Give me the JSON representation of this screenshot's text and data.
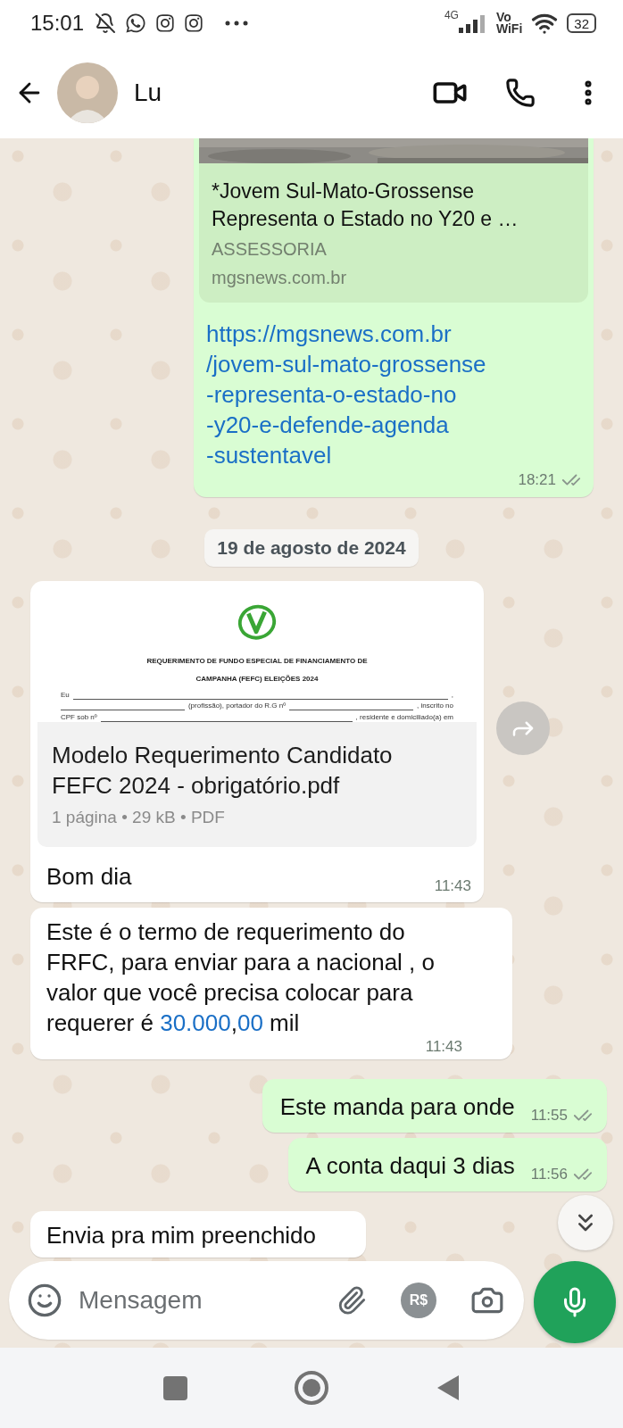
{
  "status_bar": {
    "time": "15:01",
    "network": "4G",
    "calling_top": "Vo",
    "calling_bottom": "WiFi",
    "battery": "32"
  },
  "header": {
    "contact_name": "Lu"
  },
  "messages": [
    {
      "kind": "link",
      "outgoing": true,
      "preview_title": "*Jovem Sul-Mato-Grossense Representa o Estado no Y20 e …",
      "preview_site": "ASSESSORIA",
      "preview_domain": "mgsnews.com.br",
      "url_lines": [
        "https://mgsnews.com.br",
        "/jovem-sul-mato-grossense",
        "-representa-o-estado-no",
        "-y20-e-defende-agenda",
        "-sustentavel"
      ],
      "time": "18:21",
      "read": false
    },
    {
      "kind": "date",
      "text": "19 de agosto de 2024"
    },
    {
      "kind": "document",
      "outgoing": false,
      "doc_heading": [
        "REQUERIMENTO DE FUNDO ESPECIAL DE FINANCIAMENTO DE",
        "CAMPANHA (FEFC) ELEIÇÕES 2024"
      ],
      "doc_lines": [
        [
          {
            "kind": "text",
            "text": "Eu"
          },
          {
            "kind": "blank"
          },
          {
            "kind": "text",
            "text": ","
          }
        ],
        [
          {
            "kind": "blank"
          },
          {
            "kind": "text",
            "text": "(profissão), portador do  R.G  nº"
          },
          {
            "kind": "blank"
          },
          {
            "kind": "text",
            "text": ", inscrito no"
          }
        ],
        [
          {
            "kind": "text",
            "text": "CPF sob nº"
          },
          {
            "kind": "blank"
          },
          {
            "kind": "text",
            "text": ", residente e domiciliado(a) em"
          }
        ]
      ],
      "file_name": "Modelo Requerimento Candidato FEFC 2024 - obrigatório.pdf",
      "file_meta": "1 página • 29 kB • PDF",
      "caption": "Bom dia",
      "time": "11:43"
    },
    {
      "kind": "text",
      "outgoing": false,
      "parts": [
        {
          "text": "Este é o termo de requerimento do FRFC, para enviar para a nacional , o valor que você precisa colocar para requerer é ",
          "link": false
        },
        {
          "text": "30.000",
          "link": true
        },
        {
          "text": ",",
          "link": false
        },
        {
          "text": "00",
          "link": true
        },
        {
          "text": " mil",
          "link": false
        }
      ],
      "time": "11:43"
    },
    {
      "kind": "text",
      "outgoing": true,
      "parts": [
        {
          "text": "Este manda para onde",
          "link": false
        }
      ],
      "time": "11:55",
      "read": false
    },
    {
      "kind": "text",
      "outgoing": true,
      "parts": [
        {
          "text": "A conta daqui 3 dias",
          "link": false
        }
      ],
      "time": "11:56",
      "read": false
    },
    {
      "kind": "text",
      "outgoing": false,
      "parts": [
        {
          "text": "Envia pra mim preenchido",
          "link": false
        }
      ]
    }
  ],
  "composer": {
    "placeholder": "Mensagem",
    "payment_label": "R$"
  }
}
